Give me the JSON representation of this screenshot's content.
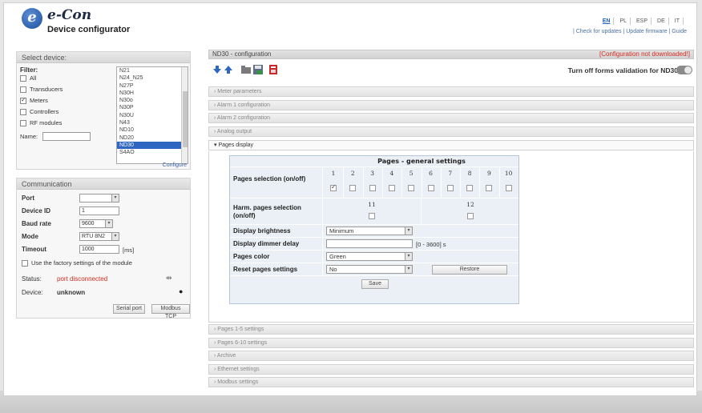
{
  "header": {
    "logo_letter": "e",
    "brand": "e-Con",
    "subtitle": "Device configurator",
    "languages": [
      "EN",
      "PL",
      "ESP",
      "DE",
      "IT"
    ],
    "active_language": "EN",
    "links": "| Check for updates | Update firmware | Guide"
  },
  "select_device": {
    "title": "Select device:",
    "filter_label": "Filter:",
    "filters": [
      {
        "label": "All",
        "checked": false
      },
      {
        "label": "Transducers",
        "checked": false
      },
      {
        "label": "Meters",
        "checked": true
      },
      {
        "label": "Controllers",
        "checked": false
      },
      {
        "label": "RF modules",
        "checked": false
      }
    ],
    "name_label": "Name:",
    "devices": [
      "N21",
      "N24_N25",
      "N27P",
      "N30H",
      "N30o",
      "N30P",
      "N30U",
      "N43",
      "ND10",
      "ND20",
      "ND30",
      "S4AO"
    ],
    "selected_device": "ND30",
    "configure_link": "Configure"
  },
  "communication": {
    "title": "Communication",
    "port_label": "Port",
    "port_value": "",
    "device_id_label": "Device ID",
    "device_id_value": "1",
    "baud_label": "Baud rate",
    "baud_value": "9600",
    "mode_label": "Mode",
    "mode_value": "RTU 8N2",
    "timeout_label": "Timeout",
    "timeout_value": "1000",
    "timeout_unit": "[ms]",
    "factory_label": "Use the factory settings of the module",
    "status_label": "Status:",
    "status_value": "port disconnected",
    "device_label": "Device:",
    "device_value": "unknown",
    "serial_button": "Serial port",
    "tcp_button": "Modbus TCP",
    "status_color": "#d62b1f"
  },
  "main": {
    "title": "ND30 - configuration",
    "warning": "[Configuration not downloaded!]",
    "validation_label": "Turn off forms validation for ND30",
    "sections_top": [
      "Meter parameters",
      "Alarm 1 configuration",
      "Alarm 2 configuration",
      "Analog output"
    ],
    "open_section": "Pages display",
    "sections_bottom": [
      "Pages 1-5 settings",
      "Pages 6-10 settings",
      "Archive",
      "Ethernet settings",
      "Modbus settings"
    ]
  },
  "pages_table": {
    "title": "Pages - general settings",
    "selection_label": "Pages selection (on/off)",
    "page_numbers": [
      "1",
      "2",
      "3",
      "4",
      "5",
      "6",
      "7",
      "8",
      "9",
      "10"
    ],
    "page_checked": [
      true,
      false,
      false,
      false,
      false,
      false,
      false,
      false,
      false,
      false
    ],
    "harm_label": "Harm. pages selection (on/off)",
    "harm_numbers": [
      "11",
      "12"
    ],
    "brightness_label": "Display brightness",
    "brightness_value": "Minimum",
    "dimmer_label": "Display dimmer delay",
    "dimmer_value": "",
    "dimmer_range": "[0 - 3600] s",
    "color_label": "Pages color",
    "color_value": "Green",
    "reset_label": "Reset pages settings",
    "reset_value": "No",
    "restore_button": "Restore",
    "save_button": "Save"
  },
  "colors": {
    "accent": "#2f66c2",
    "warning": "#d62b1f",
    "link": "#3b64a8"
  }
}
